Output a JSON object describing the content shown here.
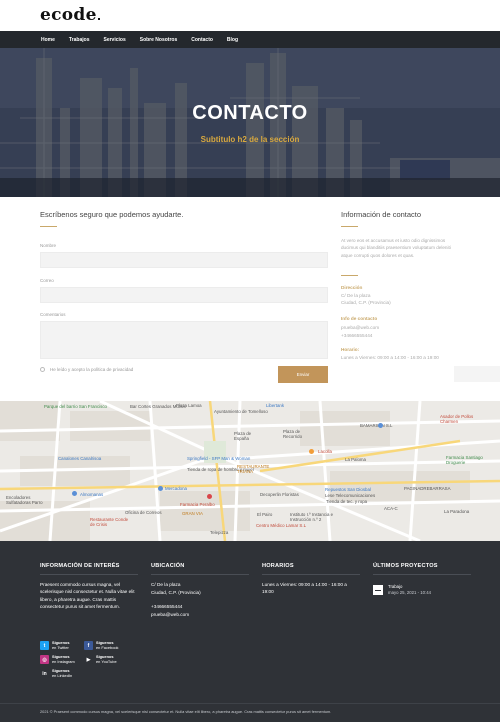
{
  "brand": {
    "logo": "ecode"
  },
  "nav": {
    "items": [
      "Home",
      "Trabajos",
      "Servicios",
      "Sobre Nosotros",
      "Contacto",
      "Blog"
    ]
  },
  "hero": {
    "title": "CONTACTO",
    "subtitle": "Subtitulo h2 de la sección"
  },
  "form": {
    "heading": "Escríbenos seguro que podemos ayudarte.",
    "name_label": "Nombre",
    "email_label": "Correo",
    "comments_label": "Comentarios",
    "privacy_text": "He leído y acepto la política de privacidad",
    "submit_label": "Enviar"
  },
  "contact_info": {
    "heading": "Información de contacto",
    "body": "At vero eos et accusamus et iusto odio dignissimos ducimus qui blanditiis praesentium voluptatum deleniti atque corrupti quos dolores et quas.",
    "address_label": "Dirección",
    "address_line1": "C/ De la plaza",
    "address_line2": "Ciudad, C.P. (Provincia)",
    "contact_label": "Info de contacto",
    "email": "prueba@web.com",
    "phone": "+34666555444",
    "hours_label": "Horario:",
    "hours": "Lunes a Viernes: 09:00 a 14:00 - 16:00 a 19:00"
  },
  "map": {
    "labels": [
      "Parque del barrio San Francisco",
      "Bar Cortes Granados Mucos",
      "Plaza Lamoa",
      "Libertank",
      "Ayuntamiento de Tomelloso",
      "Plaza de España",
      "Plaza de Recorrido",
      "BAMARSAN S.L",
      "Asador de Pollos Charmen",
      "Canalones Canalrisoa",
      "Springfield - SFP Man & Woman",
      "Tienda de ropa de hombre y mujer",
      "RESTAURANTE TRIANA",
      "Lacolla",
      "La Paloma",
      "Farmacia Santiago Droguerie",
      "Encoladores Sulfatadoras Parro",
      "Almomanas",
      "Mercadona",
      "Decoperlin Floristas",
      "Repuestos San Diosbal",
      "Lese Telecomunicaciones",
      "Tienda de tec. y ropa",
      "PAGINADREBARRASA",
      "Farmacia Peralbo",
      "Oficina de Correos",
      "GRAN VIA",
      "El Pairo",
      "Instituto I.º Instancia e Instrucción n.º 2",
      "La Paradona",
      "Restaurante Conde de Crisis",
      "Centro Médico Lamar S.L",
      "Telepizza",
      "ACA-C"
    ]
  },
  "footer": {
    "interest": {
      "heading": "INFORMACIÓN DE INTERÉS",
      "text": "Praesent commodo cursus magna, vel scelerisque nisl consectetur et. Nulla vitae elit libero, a pharetra augue. Cras mattis consectetur purus sit amet fermentum."
    },
    "location": {
      "heading": "UBICACIÓN",
      "address1": "C/ De la plaza",
      "address2": "Ciudad, C.P. (Provincia)",
      "phone": "+34666555444",
      "email": "prueba@web.com"
    },
    "hours": {
      "heading": "HORARIOS",
      "text": "Lunes a Viernes: 09:00 a 14:00 - 16:00 a 19:00"
    },
    "projects": {
      "heading": "ÚLTIMOS PROYECTOS",
      "title": "Trabajo",
      "date": "mayo 25, 2021 - 10:44"
    },
    "social": [
      {
        "name": "Síguenos",
        "net": "en Twitter",
        "icon": "twitter-icon",
        "color": "#1da1f2",
        "glyph": "t"
      },
      {
        "name": "Síguenos",
        "net": "en Facebook",
        "icon": "facebook-icon",
        "color": "#3b5998",
        "glyph": "f"
      },
      {
        "name": "Síguenos",
        "net": "en Instagram",
        "icon": "instagram-icon",
        "color": "#c13584",
        "glyph": "◎"
      },
      {
        "name": "Síguenos",
        "net": "en YouTube",
        "icon": "youtube-icon",
        "color": "#2f3237",
        "glyph": "▶"
      },
      {
        "name": "Síguenos",
        "net": "en LinkedIn",
        "icon": "linkedin-icon",
        "color": "#2f3237",
        "glyph": "in"
      }
    ],
    "copyright": "2021 © Praesent commodo cursus magna, vel scelerisque nisl consectetur et. Nulla vitae elit libero, a pharetra augue. Cras mattis consectetur purus sit amet fermentum."
  },
  "colors": {
    "accent": "#c2955a",
    "nav_bg": "#24282d",
    "footer_bg": "#2f3237",
    "hero_subtitle": "#d9a93f"
  }
}
